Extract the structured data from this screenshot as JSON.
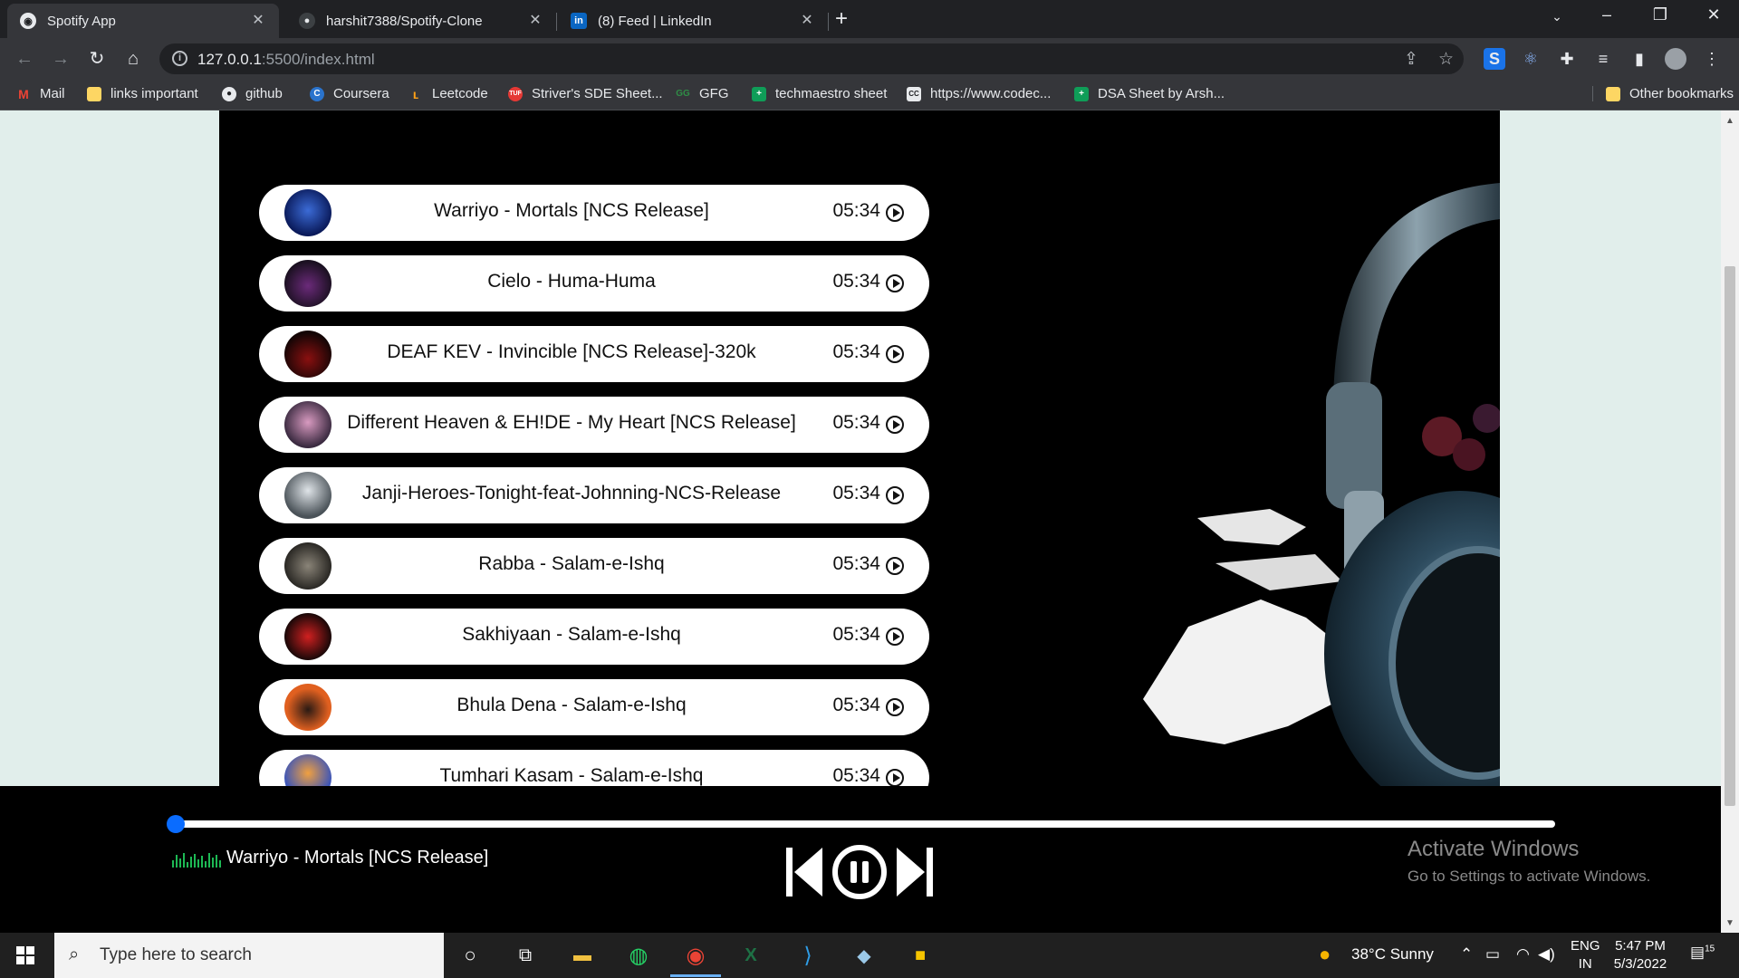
{
  "browser": {
    "tabs": [
      {
        "title": "Spotify App",
        "active": true
      },
      {
        "title": "harshit7388/Spotify-Clone",
        "active": false
      },
      {
        "title": "(8) Feed | LinkedIn",
        "active": false
      }
    ],
    "url": "127.0.0.1:5500/index.html",
    "url_host": "127.0.0.1",
    "url_rest": ":5500/index.html"
  },
  "bookmarks": [
    {
      "label": "Mail",
      "icon": "gmail-icon",
      "color": "#ea4335"
    },
    {
      "label": "links important",
      "icon": "folder-icon",
      "color": "#fdd663"
    },
    {
      "label": "github",
      "icon": "github-icon",
      "color": "#e8eaed"
    },
    {
      "label": "Coursera",
      "icon": "coursera-icon",
      "color": "#2a73cc"
    },
    {
      "label": "Leetcode",
      "icon": "leetcode-icon",
      "color": "#ffa116"
    },
    {
      "label": "Striver's SDE Sheet...",
      "icon": "tuf-icon",
      "color": "#e53935"
    },
    {
      "label": "GFG",
      "icon": "gfg-icon",
      "color": "#2f8d46"
    },
    {
      "label": "techmaestro sheet",
      "icon": "sheets-icon",
      "color": "#0f9d58"
    },
    {
      "label": "https://www.codec...",
      "icon": "codechef-icon",
      "color": "#e8eaed"
    },
    {
      "label": "DSA Sheet by Arsh...",
      "icon": "sheets-icon",
      "color": "#0f9d58"
    }
  ],
  "other_bookmarks": "Other bookmarks",
  "songs": [
    {
      "name": "Warriyo - Mortals [NCS Release]",
      "duration": "05:34"
    },
    {
      "name": "Cielo - Huma-Huma",
      "duration": "05:34"
    },
    {
      "name": "DEAF KEV - Invincible [NCS Release]-320k",
      "duration": "05:34"
    },
    {
      "name": "Different Heaven & EH!DE - My Heart [NCS Release]",
      "duration": "05:34"
    },
    {
      "name": "Janji-Heroes-Tonight-feat-Johnning-NCS-Release",
      "duration": "05:34"
    },
    {
      "name": "Rabba - Salam-e-Ishq",
      "duration": "05:34"
    },
    {
      "name": "Sakhiyaan - Salam-e-Ishq",
      "duration": "05:34"
    },
    {
      "name": "Bhula Dena - Salam-e-Ishq",
      "duration": "05:34"
    },
    {
      "name": "Tumhari Kasam - Salam-e-Ishq",
      "duration": "05:34"
    }
  ],
  "player": {
    "now_playing": "Warriyo - Mortals [NCS Release]",
    "progress": 0
  },
  "watermark": {
    "line1": "Activate Windows",
    "line2": "Go to Settings to activate Windows."
  },
  "taskbar": {
    "search_placeholder": "Type here to search",
    "weather": "38°C  Sunny",
    "lang1": "ENG",
    "lang2": "IN",
    "time": "5:47 PM",
    "date": "5/3/2022",
    "notifications": "15"
  },
  "colors": {
    "accent": "#0a6cff",
    "page_bg": "#e1eeeb",
    "eq": "#1db954"
  }
}
